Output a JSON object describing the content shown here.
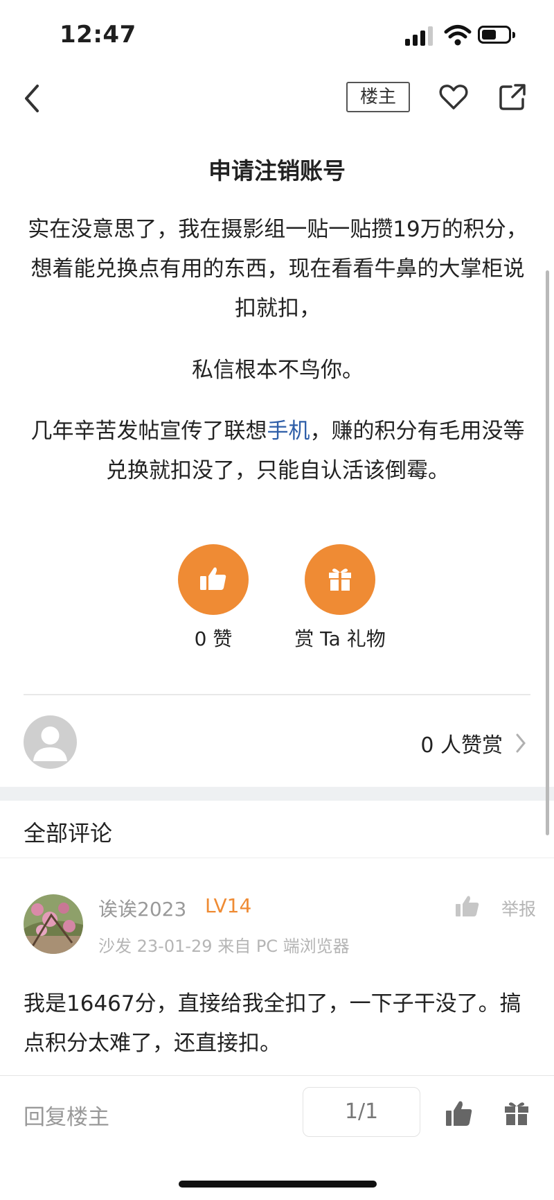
{
  "status_bar": {
    "time": "12:47"
  },
  "nav": {
    "owner_tag": "楼主"
  },
  "post": {
    "title": "申请注销账号",
    "paragraph1": "实在没意思了，我在摄影组一贴一贴攒19万的积分，想着能兑换点有用的东西，现在看看牛鼻的大掌柜说扣就扣，",
    "paragraph2": "私信根本不鸟你。",
    "paragraph3_before": "几年辛苦发帖宣传了联想",
    "paragraph3_link": "手机",
    "paragraph3_after": "，赚的积分有毛用没等兑换就扣没了，只能自认活该倒霉。",
    "like_label": "0 赞",
    "gift_label": "赏 Ta 礼物",
    "reward_count": "0 人赞赏"
  },
  "comments_section": {
    "header": "全部评论",
    "comments": [
      {
        "username": "诶诶2023",
        "level": "LV14",
        "meta": "沙发  23-01-29 来自 PC 端浏览器",
        "report_label": "举报",
        "body": "我是16467分，直接给我全扣了，一下子干没了。搞点积分太难了，还直接扣。"
      }
    ]
  },
  "bottom_bar": {
    "reply_placeholder": "回复楼主",
    "page_indicator": "1/1"
  },
  "colors": {
    "accent": "#ef8b34",
    "link": "#2e5ea8",
    "muted": "#9a9a9a"
  },
  "icons": [
    "back-arrow-icon",
    "heart-icon",
    "share-icon",
    "thumbs-up-icon",
    "gift-icon",
    "chevron-right-icon",
    "default-avatar-icon"
  ]
}
